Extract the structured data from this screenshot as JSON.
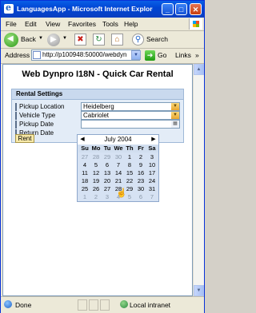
{
  "window": {
    "title": "LanguagesApp - Microsoft Internet Explorer pr..."
  },
  "menu": [
    "File",
    "Edit",
    "View",
    "Favorites",
    "Tools",
    "Help"
  ],
  "toolbar": {
    "back_label": "Back",
    "search_label": "Search"
  },
  "address": {
    "label": "Address",
    "url": "http://p100948:50000/webdyn",
    "go_label": "Go",
    "links_label": "Links"
  },
  "page": {
    "title": "Web Dynpro I18N - Quick Car Rental",
    "group_title": "Rental Settings",
    "fields": [
      {
        "label": "Pickup Location",
        "value": "Heidelberg"
      },
      {
        "label": "Vehicle Type",
        "value": "Cabriolet"
      },
      {
        "label": "Pickup Date",
        "value": ""
      },
      {
        "label": "Return Date",
        "value": ""
      }
    ],
    "rent_label": "Rent"
  },
  "calendar": {
    "month_label": "July 2004",
    "prev": "◀",
    "next": "▶",
    "weekdays": [
      "Su",
      "Mo",
      "Tu",
      "We",
      "Th",
      "Fr",
      "Sa"
    ],
    "weeks": [
      [
        "27",
        "28",
        "29",
        "30",
        "1",
        "2",
        "3"
      ],
      [
        "4",
        "5",
        "6",
        "7",
        "8",
        "9",
        "10"
      ],
      [
        "11",
        "12",
        "13",
        "14",
        "15",
        "16",
        "17"
      ],
      [
        "18",
        "19",
        "20",
        "21",
        "22",
        "23",
        "24"
      ],
      [
        "25",
        "26",
        "27",
        "28",
        "29",
        "30",
        "31"
      ],
      [
        "1",
        "2",
        "3",
        "4",
        "5",
        "6",
        "7"
      ]
    ]
  },
  "status": {
    "text": "Done",
    "zone": "Local intranet"
  }
}
